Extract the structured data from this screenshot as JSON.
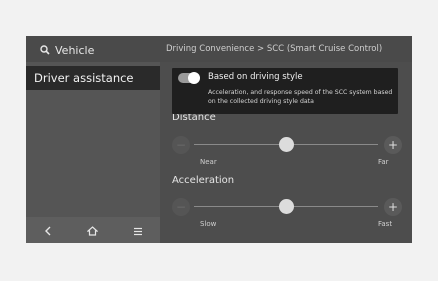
{
  "header": {
    "search_label": "Vehicle",
    "breadcrumb": "Driving Convenience > SCC (Smart Cruise Control)"
  },
  "sidebar": {
    "items": [
      {
        "label": "Driver assistance",
        "selected": true
      }
    ],
    "nav": [
      {
        "icon": "back-icon"
      },
      {
        "icon": "home-icon"
      },
      {
        "icon": "menu-icon"
      }
    ]
  },
  "settings": {
    "driving_style": {
      "title": "Based on driving style",
      "description": "Acceleration, and response speed of the SCC system based on the collected driving style data",
      "enabled": true
    },
    "distance": {
      "title": "Distance",
      "min_label": "Near",
      "max_label": "Far",
      "level": 0.5
    },
    "acceleration": {
      "title": "Acceleration",
      "min_label": "Slow",
      "max_label": "Fast",
      "level": 0.5
    }
  },
  "colors": {
    "screen_bg": "#4a4a4a",
    "selected_bg": "#2a2a2a",
    "text": "#f0f0f0"
  }
}
